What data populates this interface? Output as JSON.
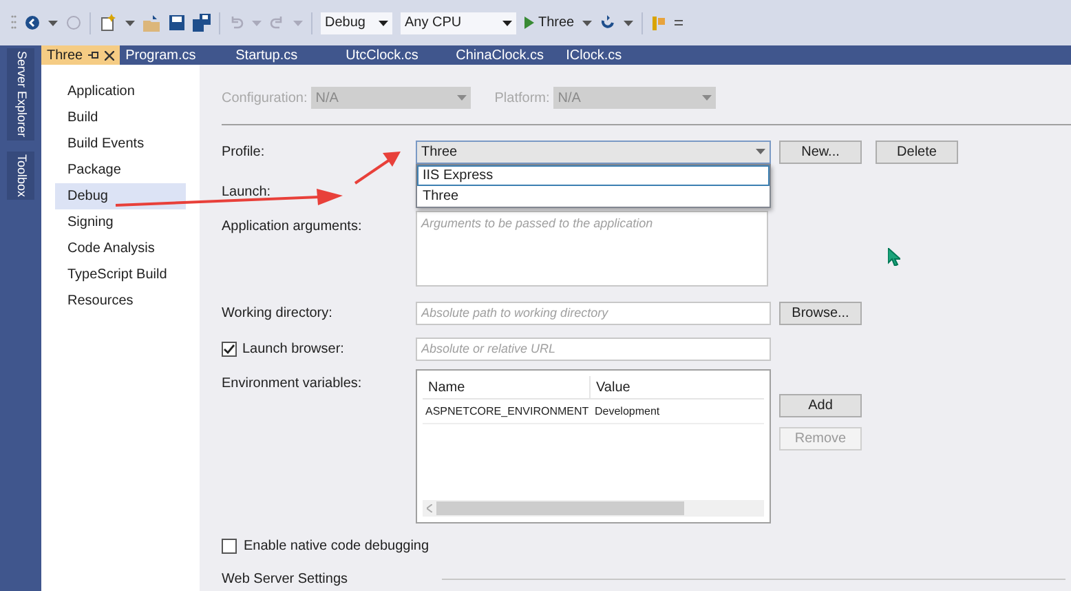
{
  "toolbar": {
    "configuration": "Debug",
    "platform": "Any CPU",
    "run_target": "Three"
  },
  "side_tabs": [
    "Server Explorer",
    "Toolbox"
  ],
  "tabs": [
    {
      "label": "Three",
      "selected": true,
      "pinned": true
    },
    {
      "label": "Program.cs",
      "selected": false,
      "pinned": false
    },
    {
      "label": "Startup.cs",
      "selected": false,
      "pinned": false
    },
    {
      "label": "UtcClock.cs",
      "selected": false,
      "pinned": false
    },
    {
      "label": "ChinaClock.cs",
      "selected": false,
      "pinned": false
    },
    {
      "label": "IClock.cs",
      "selected": false,
      "pinned": false
    }
  ],
  "nav": [
    {
      "label": "Application",
      "selected": false
    },
    {
      "label": "Build",
      "selected": false
    },
    {
      "label": "Build Events",
      "selected": false
    },
    {
      "label": "Package",
      "selected": false
    },
    {
      "label": "Debug",
      "selected": true
    },
    {
      "label": "Signing",
      "selected": false
    },
    {
      "label": "Code Analysis",
      "selected": false
    },
    {
      "label": "TypeScript Build",
      "selected": false
    },
    {
      "label": "Resources",
      "selected": false
    }
  ],
  "configuration": {
    "label": "Configuration:",
    "value": "N/A",
    "disabled": true
  },
  "platform": {
    "label": "Platform:",
    "value": "N/A",
    "disabled": true
  },
  "profile": {
    "label": "Profile:",
    "value": "Three",
    "buttons": [
      "New...",
      "Delete"
    ],
    "expanded": true,
    "options": [
      {
        "label": "IIS Express",
        "highlighted": true
      },
      {
        "label": "Three",
        "highlighted": false
      }
    ]
  },
  "launch": {
    "label": "Launch:"
  },
  "app_arguments": {
    "label": "Application arguments:",
    "placeholder": "Arguments to be passed to the application"
  },
  "working_directory": {
    "label": "Working directory:",
    "placeholder": "Absolute path to working directory",
    "button": "Browse..."
  },
  "launch_browser": {
    "label": "Launch browser:",
    "checked": true,
    "placeholder": "Absolute or relative URL"
  },
  "environment_variables": {
    "label": "Environment variables:",
    "columns": [
      "Name",
      "Value"
    ],
    "rows": [
      [
        "ASPNETCORE_ENVIRONMENT",
        "Development"
      ]
    ],
    "buttons": [
      {
        "label": "Add",
        "disabled": false
      },
      {
        "label": "Remove",
        "disabled": true
      }
    ]
  },
  "native_debugging": {
    "label": "Enable native code debugging",
    "checked": false
  },
  "section": "Web Server Settings"
}
